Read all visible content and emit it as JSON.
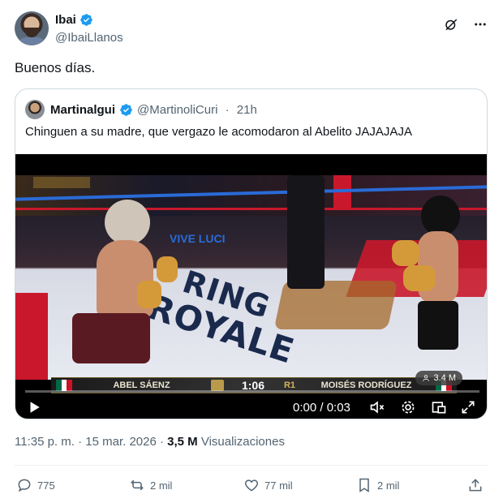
{
  "author": {
    "name": "Ibai",
    "handle": "@IbaiLlanos"
  },
  "tweet": {
    "text": "Buenos días."
  },
  "quoted": {
    "name": "Martinalgui",
    "handle": "@MartinoliCuri",
    "time_sep": " · ",
    "time": "21h",
    "text": "Chinguen a su madre, que vergazo le acomodaron al Abelito JAJAJAJA"
  },
  "video": {
    "scoreboard": {
      "left_name": "ABEL SÁENZ",
      "clock": "1:06",
      "round": "R1",
      "right_name": "MOISÉS RODRÍGUEZ"
    },
    "ring_text_1": "RING",
    "ring_text_2": "ROYALE",
    "views": "3.4 M",
    "time": "0:00 / 0:03"
  },
  "meta": {
    "time": "11:35 p. m. · 15 mar. 2026 · ",
    "views_count": "3,5 M",
    "views_label": " Visualizaciones"
  },
  "actions": {
    "replies": "775",
    "reposts": "2 mil",
    "likes": "77 mil",
    "bookmarks": "2 mil"
  },
  "icons": [
    "verified-icon",
    "grok-icon",
    "more-icon",
    "play-icon",
    "volume-mute-icon",
    "settings-icon",
    "pip-icon",
    "fullscreen-icon",
    "reply-icon",
    "repost-icon",
    "like-icon",
    "bookmark-icon",
    "share-icon"
  ],
  "colors": {
    "verified": "#1d9bf0",
    "secondary_text": "#536471",
    "border": "#cfd9de"
  }
}
